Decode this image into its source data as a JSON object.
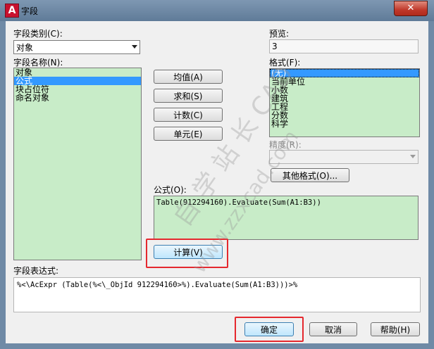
{
  "window": {
    "title": "字段",
    "app_icon": "A",
    "close": "✕"
  },
  "field_category": {
    "label": "字段类别(C):",
    "value": "对象"
  },
  "field_names": {
    "label": "字段名称(N):",
    "items": [
      "对象",
      "公式",
      "块占位符",
      "命名对象"
    ],
    "selected_index": 1
  },
  "buttons": {
    "average": "均值(A)",
    "sum": "求和(S)",
    "count": "计数(C)",
    "cell": "单元(E)"
  },
  "preview": {
    "label": "预览:",
    "value": "3"
  },
  "format": {
    "label": "格式(F):",
    "items": [
      "(无)",
      "当前单位",
      "小数",
      "建筑",
      "工程",
      "分数",
      "科学"
    ],
    "selected_index": 0
  },
  "precision": {
    "label": "精度(R):",
    "value": ""
  },
  "other_format_button": "其他格式(O)...",
  "formula": {
    "label": "公式(O):",
    "value": "Table(912294160).Evaluate(Sum(A1:B3))"
  },
  "evaluate_button": "计算(V)",
  "field_expression": {
    "label": "字段表达式:",
    "value": "%<\\AcExpr (Table(%<\\_ObjId 912294160>%).Evaluate(Sum(A1:B3)))>%"
  },
  "footer": {
    "ok": "确定",
    "cancel": "取消",
    "help": "帮助(H)"
  },
  "watermark": {
    "text1": "自 学 站 长 CAD",
    "text2": "www.zzxcad.com"
  },
  "colors": {
    "list_bg": "#c8ecc8",
    "selection": "#3399ff",
    "highlight": "#e5282e"
  }
}
